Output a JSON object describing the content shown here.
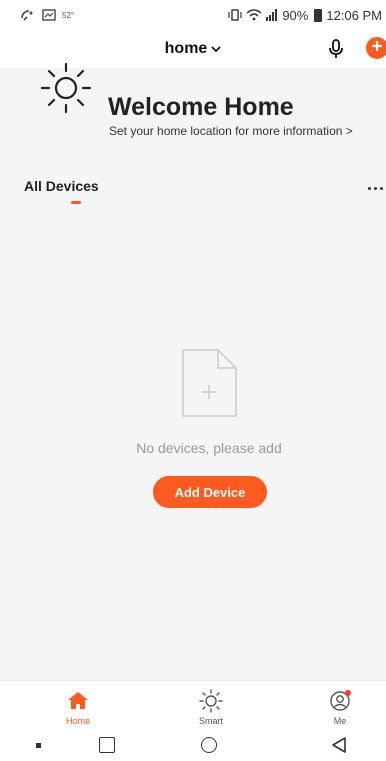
{
  "status_bar": {
    "small_text": "52°",
    "battery": "90%",
    "time": "12:06 PM"
  },
  "header": {
    "home_title": "home"
  },
  "welcome": {
    "title": "Welcome Home",
    "subtitle": "Set your home location for more information >"
  },
  "devices": {
    "section_label": "All Devices",
    "empty_text": "No devices, please add",
    "add_button_label": "Add Device"
  },
  "tabbar": {
    "tabs": [
      {
        "label": "Home",
        "icon": "home-icon",
        "active": true
      },
      {
        "label": "Smart",
        "icon": "sun-icon",
        "active": false
      },
      {
        "label": "Me",
        "icon": "user-icon",
        "active": false
      }
    ]
  },
  "colors": {
    "accent": "#ff5a1f",
    "background": "#f5f5f6"
  }
}
